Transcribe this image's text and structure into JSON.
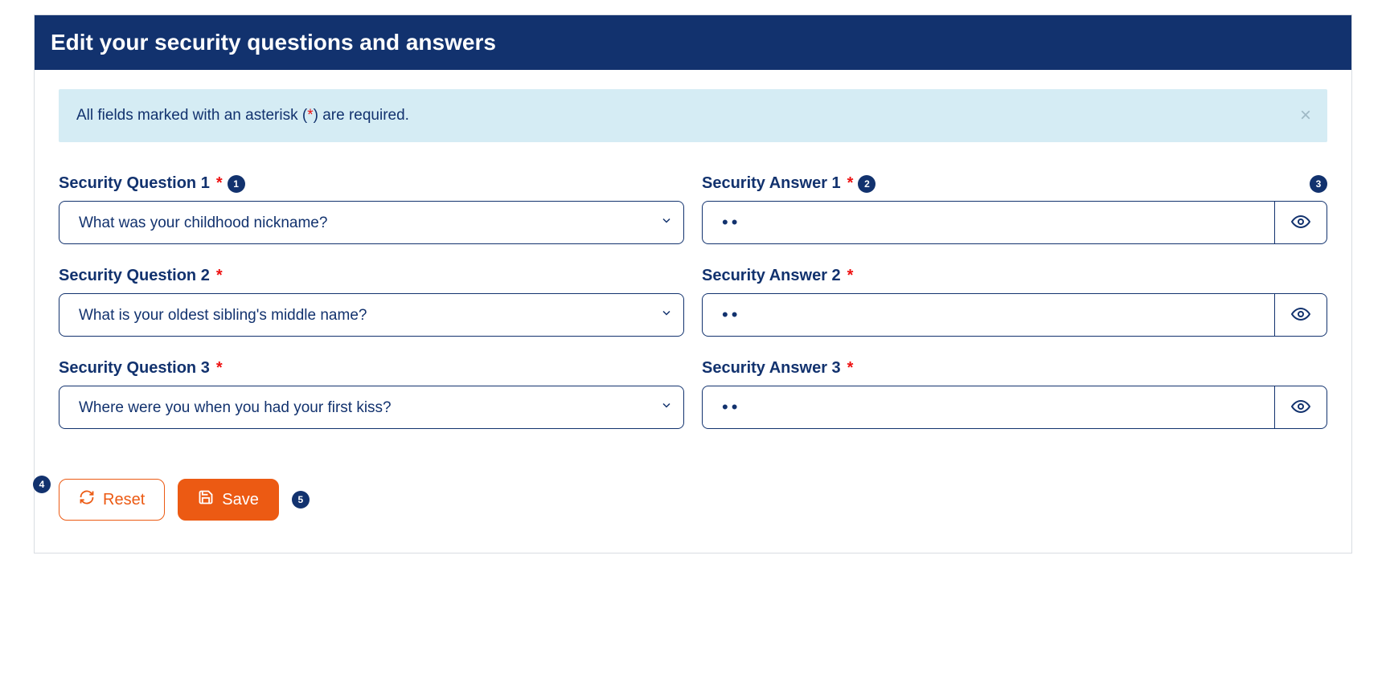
{
  "header": {
    "title": "Edit your security questions and answers"
  },
  "banner": {
    "text_prefix": "All fields marked with an asterisk (",
    "asterisk": "*",
    "text_suffix": ") are required."
  },
  "callouts": {
    "q1": "1",
    "a1": "2",
    "eye1": "3",
    "actions": "4",
    "save": "5"
  },
  "rows": [
    {
      "q_label": "Security Question 1",
      "a_label": "Security Answer 1",
      "selected": "What was your childhood nickname?",
      "answer": "••"
    },
    {
      "q_label": "Security Question 2",
      "a_label": "Security Answer 2",
      "selected": "What is your oldest sibling's middle name?",
      "answer": "••"
    },
    {
      "q_label": "Security Question 3",
      "a_label": "Security Answer 3",
      "selected": "Where were you when you had your first kiss?",
      "answer": "••"
    }
  ],
  "buttons": {
    "reset": "Reset",
    "save": "Save"
  }
}
